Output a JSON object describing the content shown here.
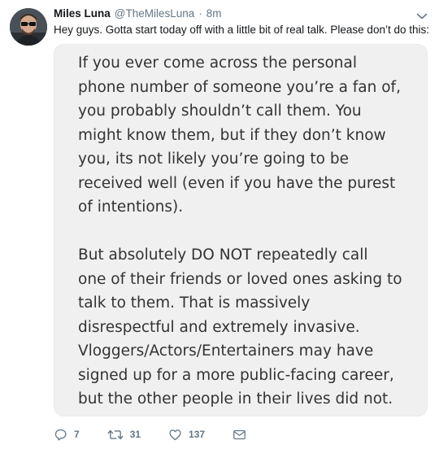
{
  "tweet": {
    "author": {
      "name": "Miles Luna",
      "handle": "@TheMilesLuna",
      "separator": "·",
      "time": "8m"
    },
    "text": "Hey guys. Gotta start today off with a little bit of real talk. Please don’t do this:",
    "note": {
      "paragraphs": [
        "If you ever come across the personal\nphone number of someone you’re a fan of,\nyou probably shouldn’t call them. You\nmight know them, but if they don’t know\nyou, its not likely you’re going to be\nreceived well (even if you have the purest\nof intentions).",
        "But absolutely DO NOT repeatedly call\none of their friends or loved ones asking to\ntalk to them. That is massively\ndisrespectful and extremely invasive.\nVloggers/Actors/Entertainers may have\nsigned up for a more public-facing career,\nbut the other people in their lives did not."
      ]
    },
    "actions": {
      "replies": "7",
      "retweets": "31",
      "likes": "137"
    }
  },
  "icons": {
    "reply": "reply-icon",
    "retweet": "retweet-icon",
    "like": "heart-icon",
    "message": "envelope-icon",
    "menu": "chevron-down-icon"
  },
  "colors": {
    "text_primary": "#14171a",
    "text_secondary": "#657786",
    "media_background": "#f0f0f0",
    "media_text": "#333333",
    "icon": "#657786"
  }
}
